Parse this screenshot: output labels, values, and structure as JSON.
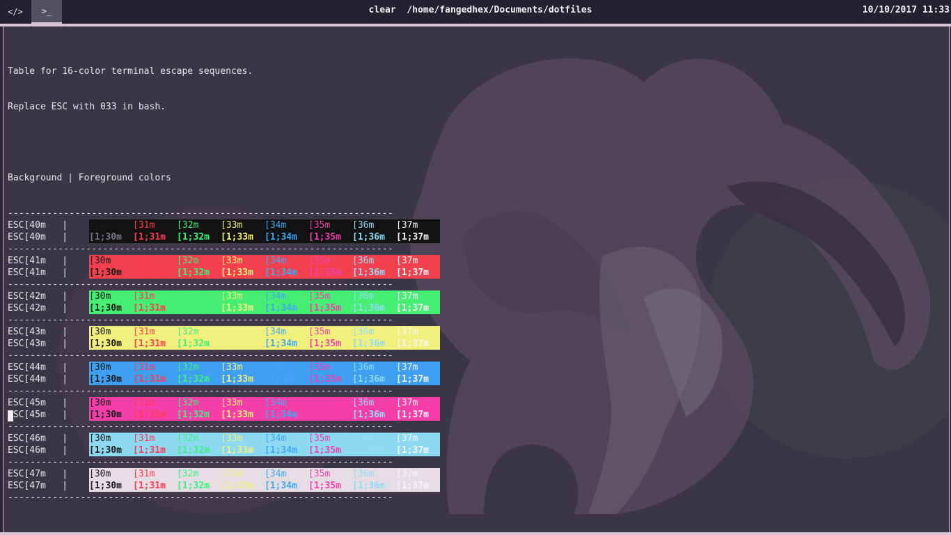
{
  "topbar": {
    "code_icon": "</>",
    "terminal_icon": ">_",
    "title": "clear  /home/fangedhex/Documents/dotfiles",
    "clock": "10/10/2017 11:33"
  },
  "terminal": {
    "intro_lines": [
      "Table for 16-color terminal escape sequences.",
      "Replace ESC with 033 in bash."
    ],
    "header": "Background | Foreground colors",
    "separator": "---------------------------------------------------------------------",
    "colors": {
      "c30": "#7a7480",
      "c31": "#ff3b52",
      "c32": "#3ff07c",
      "c33": "#f3ef7d",
      "c34": "#3fa8f2",
      "c35": "#f040b0",
      "c36": "#8fdcf7",
      "c37": "#f5f5f7",
      "black_fg": "#1a1a1a"
    },
    "rows": [
      {
        "bg": "#121212",
        "labels": [
          "ESC[40m   |",
          "ESC[40m   |"
        ]
      },
      {
        "bg": "#f2404f",
        "labels": [
          "ESC[41m   |",
          "ESC[41m   |"
        ]
      },
      {
        "bg": "#46ee74",
        "labels": [
          "ESC[42m   |",
          "ESC[42m   |"
        ]
      },
      {
        "bg": "#f1f07c",
        "labels": [
          "ESC[43m   |",
          "ESC[43m   |"
        ]
      },
      {
        "bg": "#3f9ff0",
        "labels": [
          "ESC[44m   |",
          "ESC[44m   |"
        ]
      },
      {
        "bg": "#f53ea8",
        "labels": [
          "ESC[45m   |",
          "ESC[45m   |"
        ]
      },
      {
        "bg": "#8dd9f2",
        "labels": [
          "ESC[46m   |",
          "ESC[46m   |"
        ]
      },
      {
        "bg": "#e6dde4",
        "labels": [
          "ESC[47m   |",
          "ESC[47m   |"
        ]
      }
    ],
    "normal_codes": [
      "[30m",
      "[31m",
      "[32m",
      "[33m",
      "[34m",
      "[35m",
      "[36m",
      "[37m"
    ],
    "bold_codes": [
      "[1;30m",
      "[1;31m",
      "[1;32m",
      "[1;33m",
      "[1;34m",
      "[1;35m",
      "[1;36m",
      "[1;37m"
    ]
  }
}
